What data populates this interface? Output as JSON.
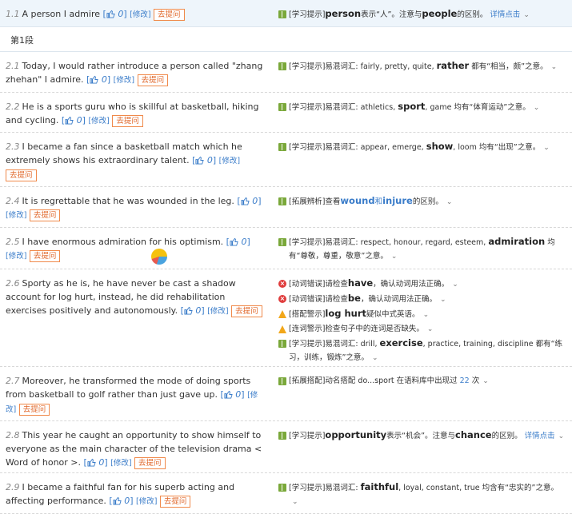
{
  "common": {
    "edit_label": "[修改]",
    "ask_label": "去提问",
    "like_open": "[",
    "like_close": "]"
  },
  "paragraph_header": "第1段",
  "rows": [
    {
      "num": "1.1",
      "text": "A person I admire",
      "likes": "0",
      "tips": [
        {
          "type": "book",
          "parts": [
            {
              "t": "[学习提示]"
            },
            {
              "t": "person",
              "kw": true
            },
            {
              "t": "表示“人”。注意与"
            },
            {
              "t": "people",
              "kw": true
            },
            {
              "t": "的区别。"
            },
            {
              "t": " 详情点击",
              "link": true
            }
          ]
        }
      ]
    },
    {
      "num": "2.1",
      "text": "Today, I would rather introduce a person called \"zhang zhehan\" I admire.",
      "likes": "0",
      "tips": [
        {
          "type": "book",
          "parts": [
            {
              "t": "[学习提示]易混词汇: fairly, pretty, quite, "
            },
            {
              "t": "rather",
              "kw": true
            },
            {
              "t": " 都有“相当，颇”之意。"
            }
          ]
        }
      ]
    },
    {
      "num": "2.2",
      "text": "He is a sports guru who is skillful at basketball, hiking and cycling.",
      "likes": "0",
      "tips": [
        {
          "type": "book",
          "parts": [
            {
              "t": "[学习提示]易混词汇: athletics, "
            },
            {
              "t": "sport",
              "kw": true
            },
            {
              "t": ", game 均有“体育运动”之意。"
            }
          ]
        }
      ]
    },
    {
      "num": "2.3",
      "text": "I became a fan since a basketball match which he extremely shows his extraordinary talent.",
      "likes": "0",
      "tips": [
        {
          "type": "book",
          "parts": [
            {
              "t": "[学习提示]易混词汇: appear, emerge, "
            },
            {
              "t": "show",
              "kw": true
            },
            {
              "t": ", loom 均有“出现”之意。"
            }
          ]
        }
      ]
    },
    {
      "num": "2.4",
      "text": "It is regrettable that he was wounded in the leg.",
      "likes": "0",
      "tips": [
        {
          "type": "book",
          "parts": [
            {
              "t": "[拓展辨析]查看"
            },
            {
              "t": "wound",
              "kwb": true
            },
            {
              "t": "和",
              "blue": true
            },
            {
              "t": "injure",
              "kwb": true
            },
            {
              "t": "的区别。"
            }
          ]
        }
      ]
    },
    {
      "num": "2.5",
      "text": "I have enormous admiration for his optimism.",
      "likes": "0",
      "tips": [
        {
          "type": "book",
          "parts": [
            {
              "t": "[学习提示]易混词汇: respect, honour, regard, esteem, "
            },
            {
              "t": "admiration",
              "kw": true
            },
            {
              "t": " 均有“尊敬，尊重，敬意”之意。"
            }
          ]
        }
      ]
    },
    {
      "num": "2.6",
      "text": "Sporty as he is, he have never be cast a shadow account for log hurt, instead, he did rehabilitation exercises positively and autonomously.",
      "likes": "0",
      "tips": [
        {
          "type": "err",
          "parts": [
            {
              "t": "[动词错误]请检查"
            },
            {
              "t": "have",
              "kw": true
            },
            {
              "t": "，确认动词用法正确。"
            }
          ]
        },
        {
          "type": "err",
          "parts": [
            {
              "t": "[动词错误]请检查"
            },
            {
              "t": "be",
              "kw": true
            },
            {
              "t": "，确认动词用法正确。"
            }
          ]
        },
        {
          "type": "warn",
          "parts": [
            {
              "t": "[搭配警示]"
            },
            {
              "t": "log hurt",
              "kw": true
            },
            {
              "t": "疑似中式英语。"
            }
          ]
        },
        {
          "type": "warn",
          "parts": [
            {
              "t": "[连词警示]检查句子中的连词是否缺失。"
            }
          ]
        },
        {
          "type": "book",
          "parts": [
            {
              "t": "[学习提示]易混词汇: drill, "
            },
            {
              "t": "exercise",
              "kw": true
            },
            {
              "t": ", practice, training, discipline 都有“练习，训练，锻炼”之意。"
            }
          ]
        }
      ]
    },
    {
      "num": "2.7",
      "text": "Moreover, he transformed the mode of doing sports from basketball to golf rather than just gave up.",
      "likes": "0",
      "tips": [
        {
          "type": "book",
          "parts": [
            {
              "t": "[拓展搭配]动名搭配 do...sport 在语料库中出现过 "
            },
            {
              "t": "22",
              "link": true
            },
            {
              "t": " 次"
            }
          ]
        }
      ]
    },
    {
      "num": "2.8",
      "text": "This year he caught an opportunity to show himself to everyone as the main character of the television drama < Word of honor >.",
      "likes": "0",
      "tips": [
        {
          "type": "book",
          "parts": [
            {
              "t": "[学习提示]"
            },
            {
              "t": "opportunity",
              "kw": true
            },
            {
              "t": "表示“机会”。注意与"
            },
            {
              "t": "chance",
              "kw": true
            },
            {
              "t": "的区别。"
            },
            {
              "t": " 详情点击",
              "link": true
            }
          ]
        }
      ]
    },
    {
      "num": "2.9",
      "text": "I became a faithful fan for his superb acting and affecting performance.",
      "likes": "0",
      "tips": [
        {
          "type": "book",
          "parts": [
            {
              "t": "[学习提示]易混词汇: "
            },
            {
              "t": "faithful",
              "kw": true
            },
            {
              "t": ", loyal, constant, true 均含有“忠实的”之意。"
            }
          ]
        }
      ]
    }
  ]
}
